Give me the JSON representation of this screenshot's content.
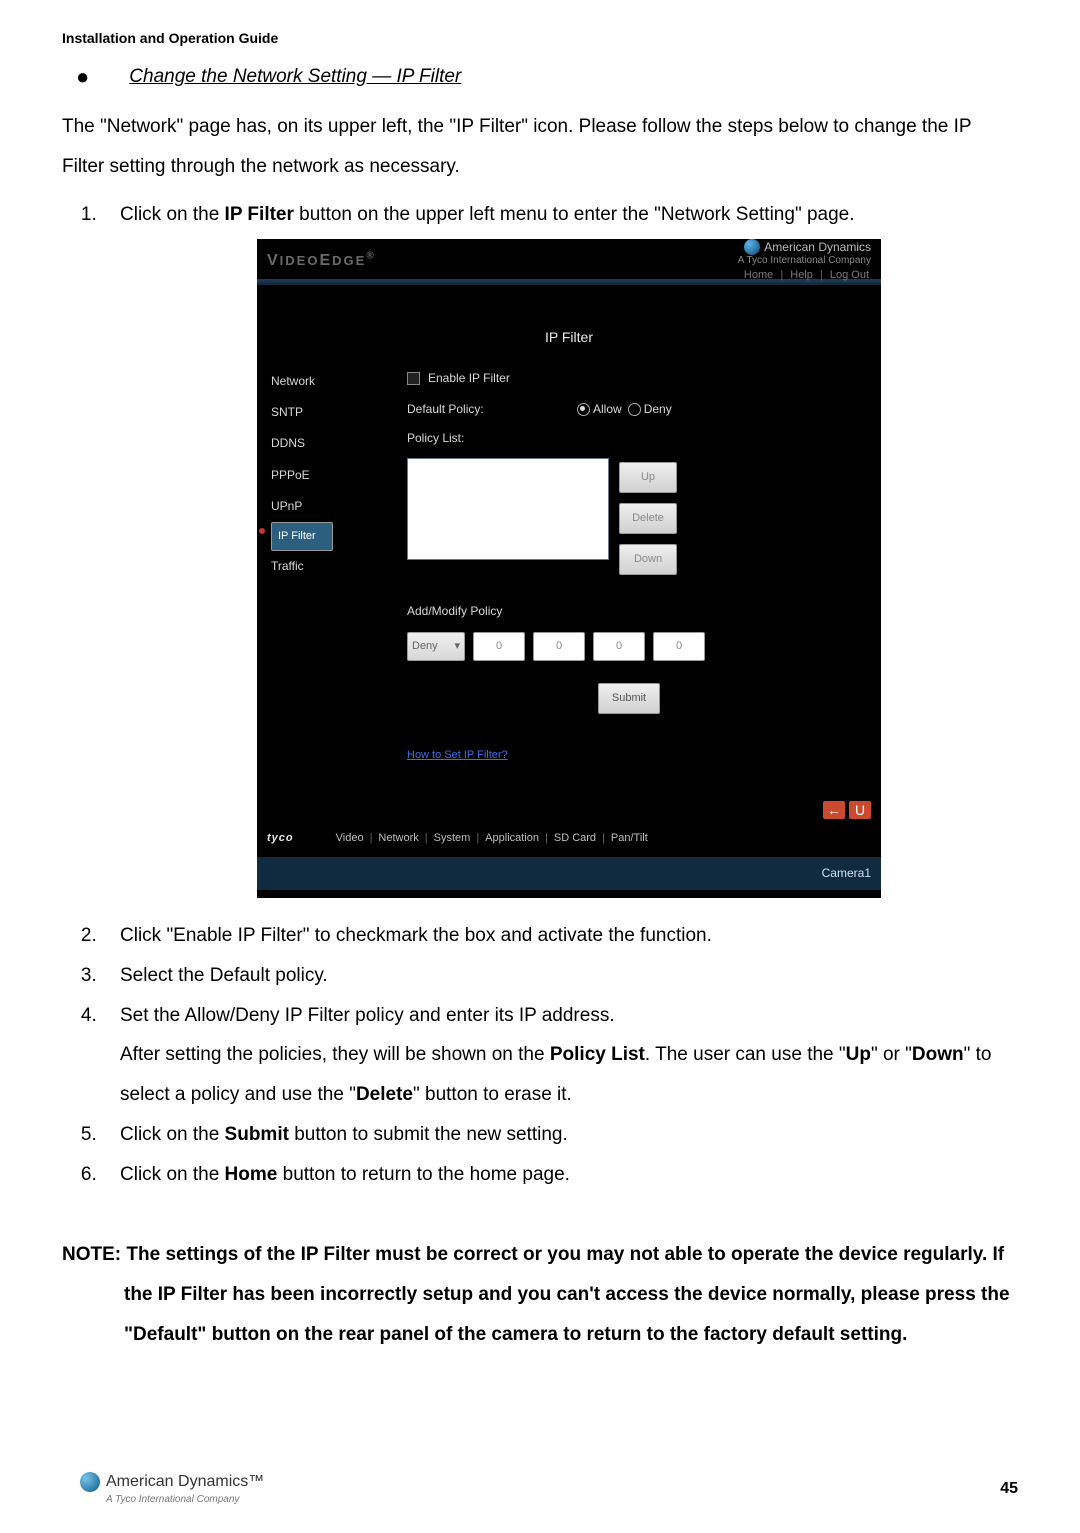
{
  "doc_title": "Installation and Operation Guide",
  "section_heading": "Change the Network Setting — IP Filter",
  "intro": "The \"Network\" page has, on its upper left, the \"IP Filter\" icon. Please follow the steps below to change the IP Filter setting through the network as necessary.",
  "steps": {
    "s1_pre": "Click on the ",
    "s1_bold": "IP Filter",
    "s1_post": " button on the upper left menu to enter the \"Network Setting\" page.",
    "s2": "Click \"Enable IP Filter\" to checkmark the box and activate the function.",
    "s3": "Select the Default policy.",
    "s4a": "Set the Allow/Deny IP Filter policy and enter its IP address.",
    "s4b_pre": "After setting the policies, they will be shown on the ",
    "s4b_pl": "Policy List",
    "s4b_mid1": ". The user can use the \"",
    "s4b_up": "Up",
    "s4b_mid2": "\" or \"",
    "s4b_down": "Down",
    "s4b_mid3": "\" to select a policy and use the \"",
    "s4b_del": "Delete",
    "s4b_post": "\" button to erase it.",
    "s5_pre": "Click on the ",
    "s5_bold": "Submit",
    "s5_post": " button to submit the new setting.",
    "s6_pre": "Click on the ",
    "s6_bold": "Home",
    "s6_post": " button to return to the home page."
  },
  "note_label": "NOTE: ",
  "note_body": "The settings of the IP Filter must be correct or you may not able to operate the device regularly. If the IP Filter has been incorrectly setup and you can't access the device normally, please press the \"Default\" button on the rear panel of the camera to return to the factory default setting.",
  "page_number": "45",
  "footer_brand": "American Dynamics™",
  "footer_sub": "A Tyco International Company",
  "shot": {
    "logo": "VIDEOEDGE",
    "brand": "American Dynamics",
    "brand_sub": "A Tyco International Company",
    "hdr_links": [
      "Home",
      "Help",
      "Log Out"
    ],
    "panel_title": "IP Filter",
    "nav": [
      "Network",
      "SNTP",
      "DDNS",
      "PPPoE",
      "UPnP",
      "IP Filter",
      "Traffic"
    ],
    "enable_label": "Enable IP Filter",
    "default_policy_label": "Default Policy:",
    "allow": "Allow",
    "deny": "Deny",
    "policy_list_label": "Policy List:",
    "btn_up": "Up",
    "btn_delete": "Delete",
    "btn_down": "Down",
    "add_modify": "Add/Modify Policy",
    "sel_value": "Deny",
    "ip": [
      "0",
      "0",
      "0",
      "0"
    ],
    "submit": "Submit",
    "how_link": "How to Set IP Filter?",
    "tyco": "tyco",
    "bottom_nav": [
      "Video",
      "Network",
      "System",
      "Application",
      "SD Card",
      "Pan/Tilt"
    ],
    "back_arrow": "←",
    "u": "U",
    "camera": "Camera1"
  }
}
